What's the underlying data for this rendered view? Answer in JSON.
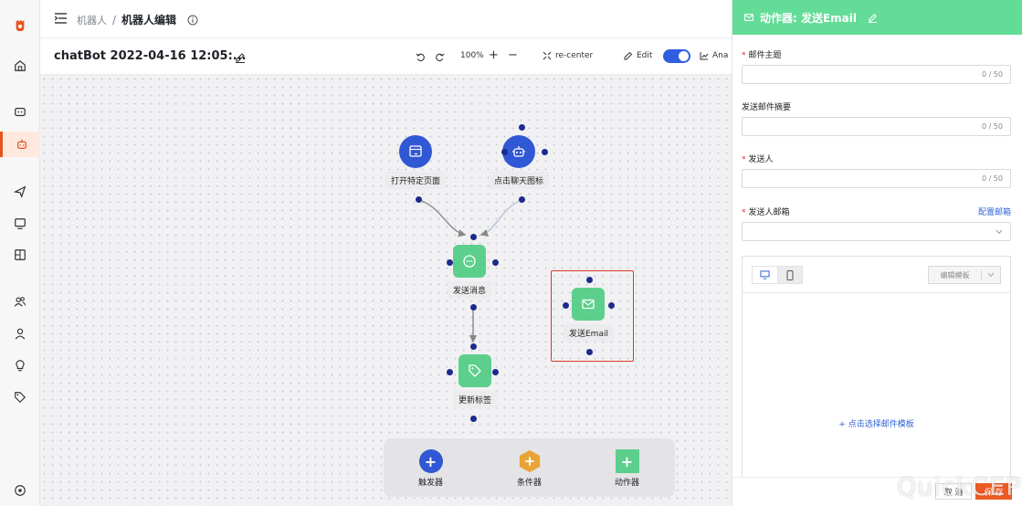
{
  "header": {
    "breadcrumb_parent": "机器人",
    "breadcrumb_sep": "/",
    "breadcrumb_current": "机器人编辑"
  },
  "toolbar": {
    "flow_name": "chatBot 2022-04-16 12:05:...",
    "zoom": "100%",
    "recenter_label": "re-center",
    "edit_label": "Edit",
    "analytics_label": "Ana",
    "edit_enabled": true
  },
  "canvas": {
    "nodes": {
      "open_page": "打开特定页面",
      "click_chat_icon": "点击聊天图标",
      "send_message": "发送消息",
      "update_tag": "更新标签",
      "send_email": "发送Email"
    }
  },
  "palette": {
    "trigger": "触发器",
    "condition": "条件器",
    "action": "动作器"
  },
  "panel": {
    "title": "动作器: 发送Email",
    "fields": {
      "subject_label": "邮件主题",
      "subject_count": "0 / 50",
      "summary_label": "发送邮件摘要",
      "summary_count": "0 / 50",
      "sender_label": "发送人",
      "sender_count": "0 / 50",
      "sender_email_label": "发送人邮箱",
      "config_mailbox_link": "配置邮箱"
    },
    "editor": {
      "template_button": "编辑模板",
      "choose_template_link": "+ 点击选择邮件模板"
    },
    "footer": {
      "cancel": "取 消",
      "confirm": "保 存"
    }
  },
  "watermark": "QuickCEP",
  "colors": {
    "accent_green": "#62dc96",
    "node_blue": "#3158d4",
    "brand_orange": "#e8541e",
    "selection_red": "#e0332a"
  }
}
